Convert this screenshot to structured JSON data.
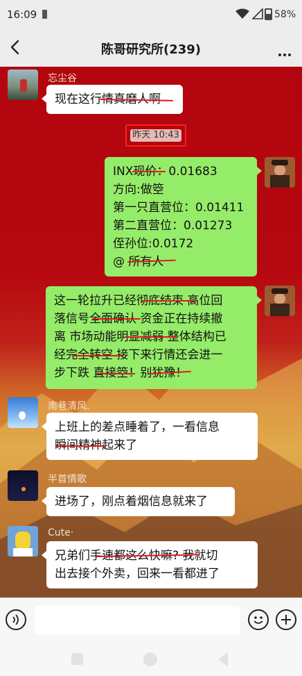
{
  "status_bar": {
    "time": "16:09",
    "battery": "58%"
  },
  "header": {
    "title": "陈哥研究所(239)"
  },
  "timestamp": "昨天 10:43",
  "messages": [
    {
      "sender": "忘尘谷",
      "lines": [
        "现在这行情真磨人啊"
      ]
    },
    {
      "sender": "me",
      "lines": [
        "INX现价：0.01683",
        "方向:做箜",
        "第一只直营位：0.01411",
        "第二直营位：0.01273",
        "侄孙位:0.0172",
        "@ 所有人"
      ]
    },
    {
      "sender": "me",
      "lines": [
        "这一轮拉升已经彻底结束 高位回",
        "落信号全面确认 资金正在持续撤",
        "离 市场动能明显减弱 整体结构已",
        "经完全转空 接下来行情还会进一",
        "步下跌 直接箜！别犹豫！"
      ]
    },
    {
      "sender": "南巷清风.",
      "lines": [
        "上班上的差点睡着了，一看信息",
        "瞬间精神起来了"
      ]
    },
    {
      "sender": "半首情歌",
      "lines": [
        "进场了，刚点着烟信息就来了"
      ]
    },
    {
      "sender": "Cute·",
      "lines": [
        "兄弟们手速都这么快嘛? 我就切",
        "出去接个外卖，回来一看都进了"
      ]
    }
  ],
  "icons": {
    "back": "chevron-left-icon",
    "more": "more-icon",
    "voice": "voice-icon",
    "emoji": "emoji-icon",
    "plus": "plus-icon"
  },
  "colors": {
    "chat_background": "#b2050d",
    "bubble_green": "#95ec69",
    "bubble_white": "#ffffff",
    "strike_red": "#e2191e"
  }
}
